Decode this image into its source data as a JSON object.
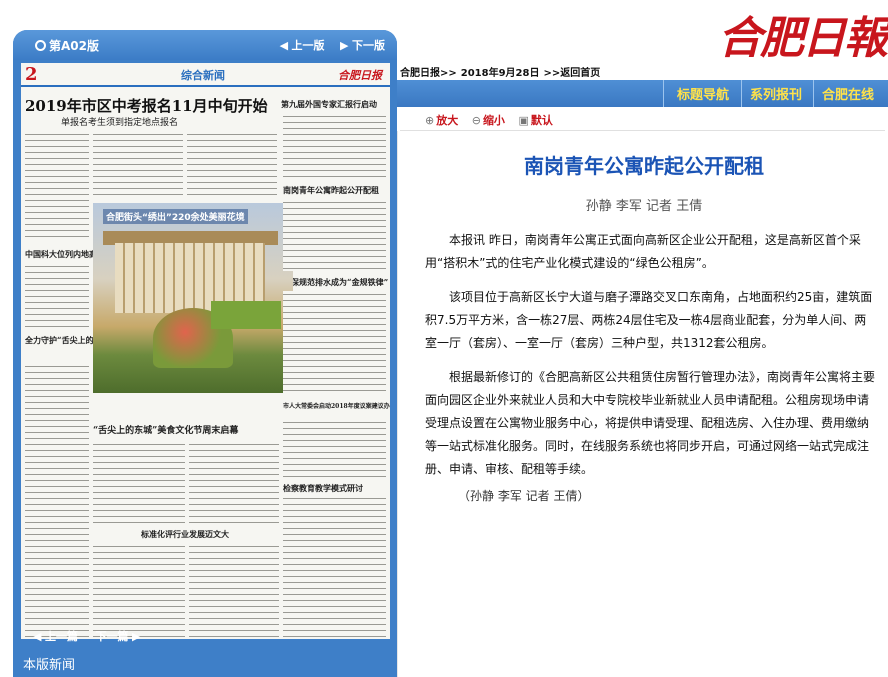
{
  "left_panel": {
    "edition": "第A02版",
    "prev_page": "上一版",
    "next_page": "下一版",
    "prev_article": "上一篇",
    "next_article": "下一篇",
    "page_news": "本版新闻"
  },
  "newspaper_thumb": {
    "page_number": "2",
    "section": "综合新闻",
    "masthead": "合肥日报",
    "headline": "2019年市区中考报名11月中旬开始",
    "subheadline": "单报名考生须到指定地点报名",
    "headlines": [
      "第九届外国专家汇报行启动",
      "中国科大位列内地高校第三",
      "合肥街头“绣出”220余处美丽花境",
      "南岗青年公寓昨起公开配租",
      "确保规范排水成为“金规铁律”",
      "全力守护“舌尖上的安全”",
      "“舌尖上的东城”美食文化节周末启幕",
      "标准化评行业发展迈文大",
      "市人大常委会启动2018年度议案建议办理情况评估工作",
      "检察教育教学模式研讨"
    ]
  },
  "header": {
    "masthead_logo": "合肥日報",
    "breadcrumb": {
      "paper": "合肥日报>>",
      "date": "2018年9月28日",
      "back": ">>返回首页"
    },
    "nav": [
      "标题导航",
      "系列报刊",
      "合肥在线"
    ]
  },
  "tools": {
    "zoom_in": "放大",
    "zoom_out": "缩小",
    "default": "默认"
  },
  "article": {
    "title": "南岗青年公寓昨起公开配租",
    "byline": "孙静  李军  记者  王倩",
    "paragraphs": [
      "本报讯 昨日，南岗青年公寓正式面向高新区企业公开配租，这是高新区首个采用“搭积木”式的住宅产业化模式建设的“绿色公租房”。",
      "该项目位于高新区长宁大道与磨子潭路交叉口东南角，占地面积约25亩，建筑面积7.5万平方米，含一栋27层、两栋24层住宅及一栋4层商业配套，分为单人间、两室一厅（套房）、一室一厅（套房）三种户型，共1312套公租房。",
      "根据最新修订的《合肥高新区公共租赁住房暂行管理办法》，南岗青年公寓将主要面向园区企业外来就业人员和大中专院校毕业新就业人员申请配租。公租房现场申请受理点设置在公寓物业服务中心，将提供申请受理、配租选房、入住办理、费用缴纳等一站式标准化服务。同时，在线服务系统也将同步开启，可通过网络一站式完成注册、申请、审核、配租等手续。"
    ],
    "signature": "（孙静  李军  记者  王倩）"
  }
}
